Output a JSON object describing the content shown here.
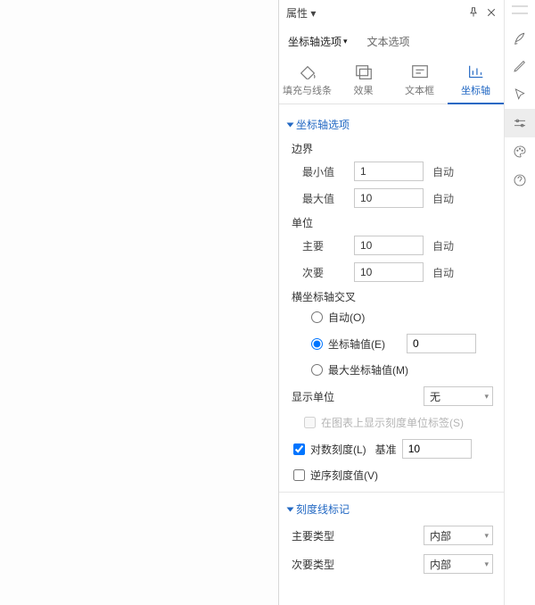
{
  "header": {
    "title": "属性 ▾"
  },
  "subtabs": {
    "axis_options": "坐标轴选项",
    "text_options": "文本选项"
  },
  "iconTabs": {
    "fill": "填充与线条",
    "effects": "效果",
    "textbox": "文本框",
    "axis": "坐标轴"
  },
  "sections": {
    "axis_options": "坐标轴选项",
    "tick_marks": "刻度线标记"
  },
  "bounds": {
    "group": "边界",
    "min_label": "最小值",
    "min_value": "1",
    "max_label": "最大值",
    "max_value": "10",
    "auto": "自动"
  },
  "units": {
    "group": "单位",
    "major_label": "主要",
    "major_value": "10",
    "minor_label": "次要",
    "minor_value": "10",
    "auto": "自动"
  },
  "cross": {
    "group": "横坐标轴交叉",
    "auto": "自动(O)",
    "value_label": "坐标轴值(E)",
    "value": "0",
    "max": "最大坐标轴值(M)"
  },
  "display_units": {
    "label": "显示单位",
    "value": "无",
    "show_label_chk": "在图表上显示刻度单位标签(S)"
  },
  "log": {
    "label": "对数刻度(L)",
    "base_label": "基准",
    "base_value": "10"
  },
  "reverse": {
    "label": "逆序刻度值(V)"
  },
  "ticks": {
    "major_label": "主要类型",
    "major_value": "内部",
    "minor_label": "次要类型",
    "minor_value": "内部"
  }
}
